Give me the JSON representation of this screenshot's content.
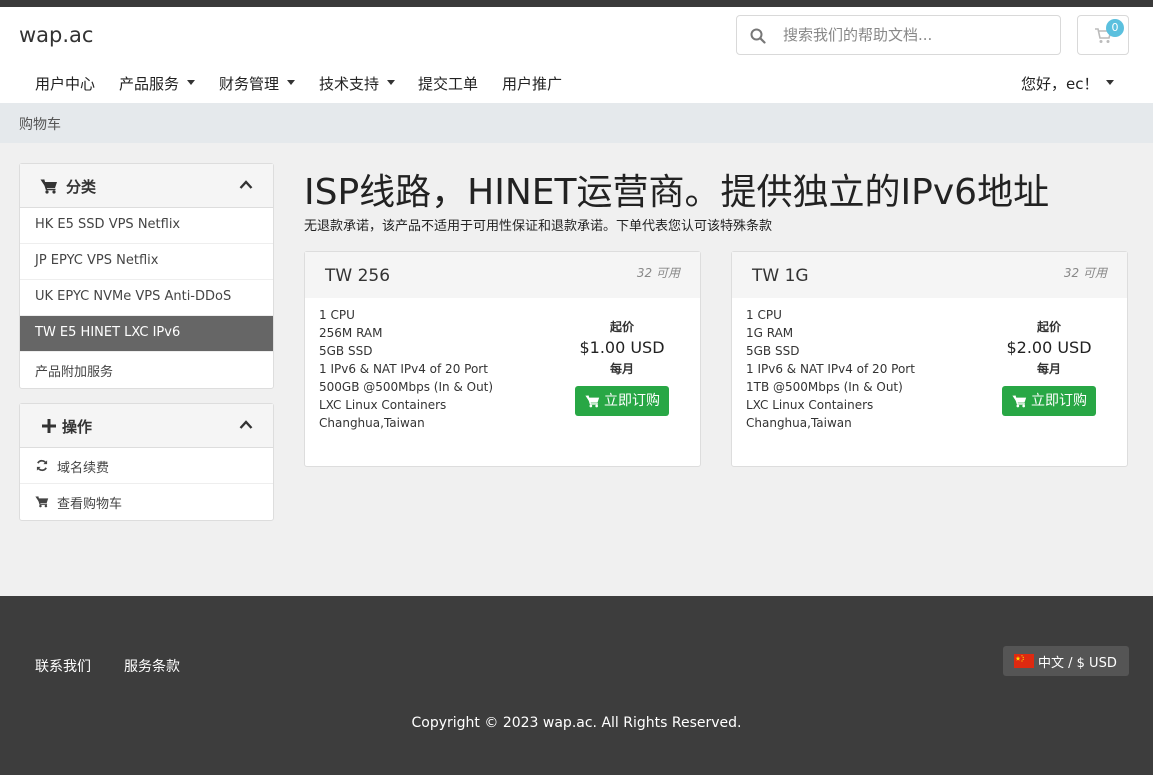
{
  "header": {
    "logo": "wap.ac",
    "search_placeholder": "搜索我们的帮助文档...",
    "cart_count": "0"
  },
  "nav": {
    "items": [
      {
        "label": "用户中心"
      },
      {
        "label": "产品服务"
      },
      {
        "label": "财务管理"
      },
      {
        "label": "技术支持"
      },
      {
        "label": "提交工单"
      },
      {
        "label": "用户推广"
      }
    ],
    "user": "您好，ec！"
  },
  "breadcrumb": "购物车",
  "sidebar": {
    "categories": {
      "title": "分类",
      "items": [
        {
          "label": "HK E5 SSD VPS Netflix"
        },
        {
          "label": "JP EPYC VPS Netflix"
        },
        {
          "label": "UK EPYC NVMe VPS Anti-DDoS"
        },
        {
          "label": "TW E5 HINET LXC IPv6"
        },
        {
          "label": "产品附加服务"
        }
      ]
    },
    "actions": {
      "title": "操作",
      "items": [
        {
          "label": "域名续费"
        },
        {
          "label": "查看购物车"
        }
      ]
    }
  },
  "page": {
    "title": "ISP线路，HINET运营商。提供独立的IPv6地址",
    "subtitle": "无退款承诺，该产品不适用于可用性保证和退款承诺。下单代表您认可该特殊条款"
  },
  "products": [
    {
      "name": "TW 256",
      "available": "32 可用",
      "features": [
        "1 CPU",
        "256M RAM",
        "5GB SSD",
        "1 IPv6 & NAT IPv4 of 20 Port",
        "500GB @500Mbps (In & Out)",
        "LXC Linux Containers",
        "Changhua,Taiwan"
      ],
      "from": "起价",
      "price": "$1.00 USD",
      "cycle": "每月",
      "order": "立即订购"
    },
    {
      "name": "TW 1G",
      "available": "32 可用",
      "features": [
        "1 CPU",
        "1G RAM",
        "5GB SSD",
        "1 IPv6 & NAT IPv4 of 20 Port",
        "1TB @500Mbps (In & Out)",
        "LXC Linux Containers",
        "Changhua,Taiwan"
      ],
      "from": "起价",
      "price": "$2.00 USD",
      "cycle": "每月",
      "order": "立即订购"
    }
  ],
  "footer": {
    "links": [
      {
        "label": "联系我们"
      },
      {
        "label": "服务条款"
      }
    ],
    "language": "中文 / $ USD",
    "copyright": "Copyright © 2023 wap.ac. All Rights Reserved."
  },
  "colors": {
    "accent_green": "#28a745",
    "badge_blue": "#5bc0de",
    "footer_bg": "#3d3d3d",
    "active_item_bg": "#666666"
  }
}
